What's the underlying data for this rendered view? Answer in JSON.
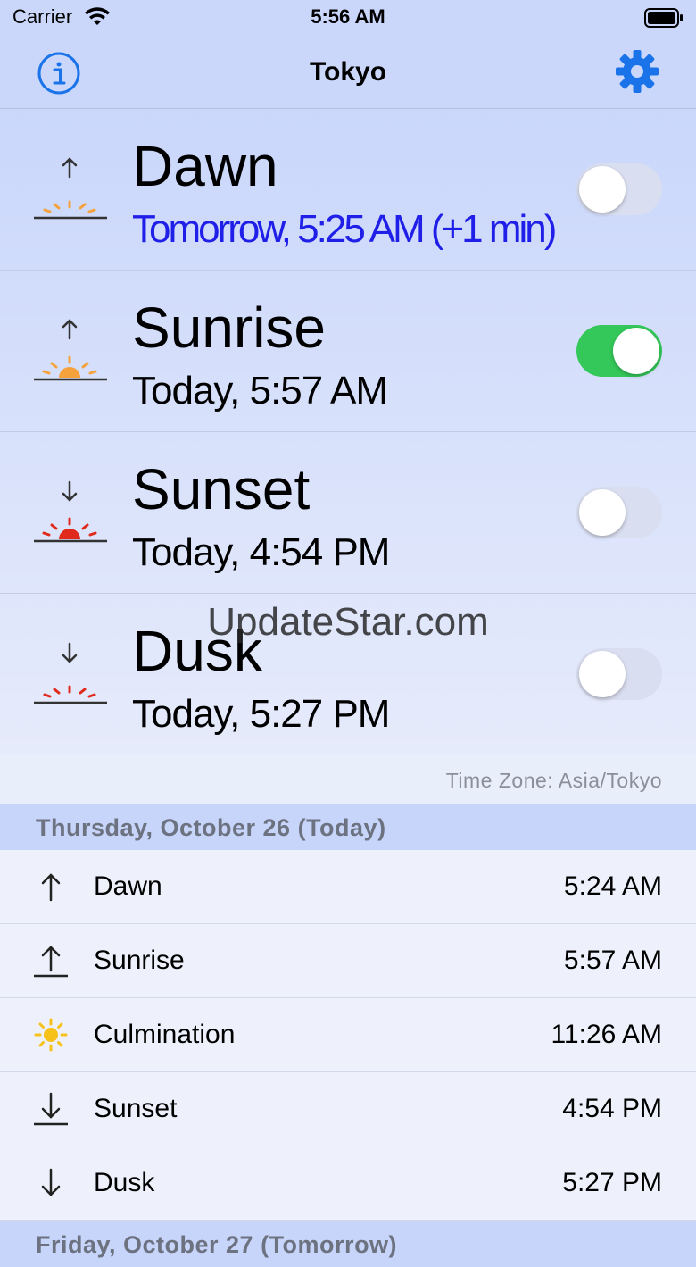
{
  "status_bar": {
    "carrier": "Carrier",
    "time": "5:56 AM"
  },
  "nav": {
    "title": "Tokyo"
  },
  "events": [
    {
      "name": "Dawn",
      "time": "Tomorrow, 5:25 AM (+1 min)",
      "toggle_on": false
    },
    {
      "name": "Sunrise",
      "time": "Today, 5:57 AM",
      "toggle_on": true
    },
    {
      "name": "Sunset",
      "time": "Today, 4:54 PM",
      "toggle_on": false
    },
    {
      "name": "Dusk",
      "time": "Today, 5:27 PM",
      "toggle_on": false
    }
  ],
  "watermark": "UpdateStar.com",
  "timezone": "Time Zone: Asia/Tokyo",
  "today_header": "Thursday, October 26 (Today)",
  "today_list": [
    {
      "label": "Dawn",
      "time": "5:24 AM",
      "icon": "arrow-up-icon"
    },
    {
      "label": "Sunrise",
      "time": "5:57 AM",
      "icon": "sunrise-arrow-icon"
    },
    {
      "label": "Culmination",
      "time": "11:26 AM",
      "icon": "sun-icon"
    },
    {
      "label": "Sunset",
      "time": "4:54 PM",
      "icon": "sunset-arrow-icon"
    },
    {
      "label": "Dusk",
      "time": "5:27 PM",
      "icon": "arrow-down-icon"
    }
  ],
  "next_header": "Friday, October 27 (Tomorrow)",
  "colors": {
    "accent": "#1a73e8",
    "toggle_on": "#34c759",
    "dawn_time": "#1f1fe8",
    "sunrise_rays": "#f5a23c",
    "sunset_rays": "#e02a1c",
    "culmination_sun": "#f6c21a"
  }
}
